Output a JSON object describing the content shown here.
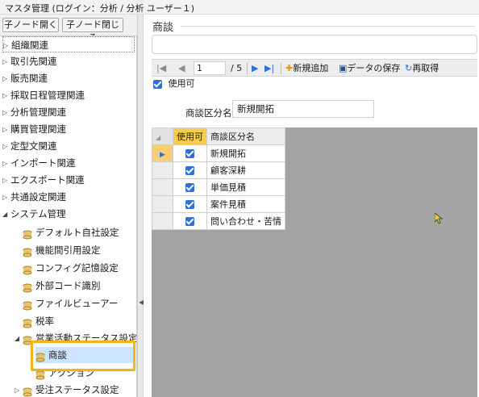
{
  "window": {
    "title": "マスタ管理 (ログイン：分析 / 分析 ユーザー１)"
  },
  "tree_toolbar": {
    "expand_label": "子ノード開く",
    "collapse_label": "子ノード閉じる"
  },
  "tree": {
    "top_items": [
      "組織関連",
      "取引先関連",
      "販売関連",
      "採取日程管理関連",
      "分析管理関連",
      "購買管理関連",
      "定型文関連",
      "インポート関連",
      "エクスポート関連",
      "共通設定関連",
      "システム管理"
    ],
    "system_children": [
      "デフォルト自社設定",
      "機能間引用設定",
      "コンフィグ記憶設定",
      "外部コード識別",
      "ファイルビューアー",
      "税率",
      "営業活動ステータス設定"
    ],
    "activity_children": [
      "商談",
      "アクション"
    ],
    "last_item": "受注ステータス設定"
  },
  "main": {
    "section_title": "商談",
    "pager": {
      "current_page": "1",
      "total_pages": "/ 5",
      "add_label": "新規追加",
      "save_label": "データの保存",
      "reload_label": "再取得"
    },
    "usable_checkbox_label": "使用可",
    "field_label": "商談区分名:",
    "field_value": "新規開拓",
    "grid": {
      "columns": [
        "使用可",
        "商談区分名"
      ],
      "rows": [
        {
          "usable": true,
          "name": "新規開拓"
        },
        {
          "usable": true,
          "name": "顧客深耕"
        },
        {
          "usable": true,
          "name": "単価見積"
        },
        {
          "usable": true,
          "name": "案件見積"
        },
        {
          "usable": true,
          "name": "問い合わせ・苦情"
        }
      ]
    }
  },
  "colors": {
    "accent": "#2a6fdc",
    "highlight": "#f6b21b",
    "selected_col": "#f6cd4b",
    "grid_bg": "#a3a3a3"
  }
}
